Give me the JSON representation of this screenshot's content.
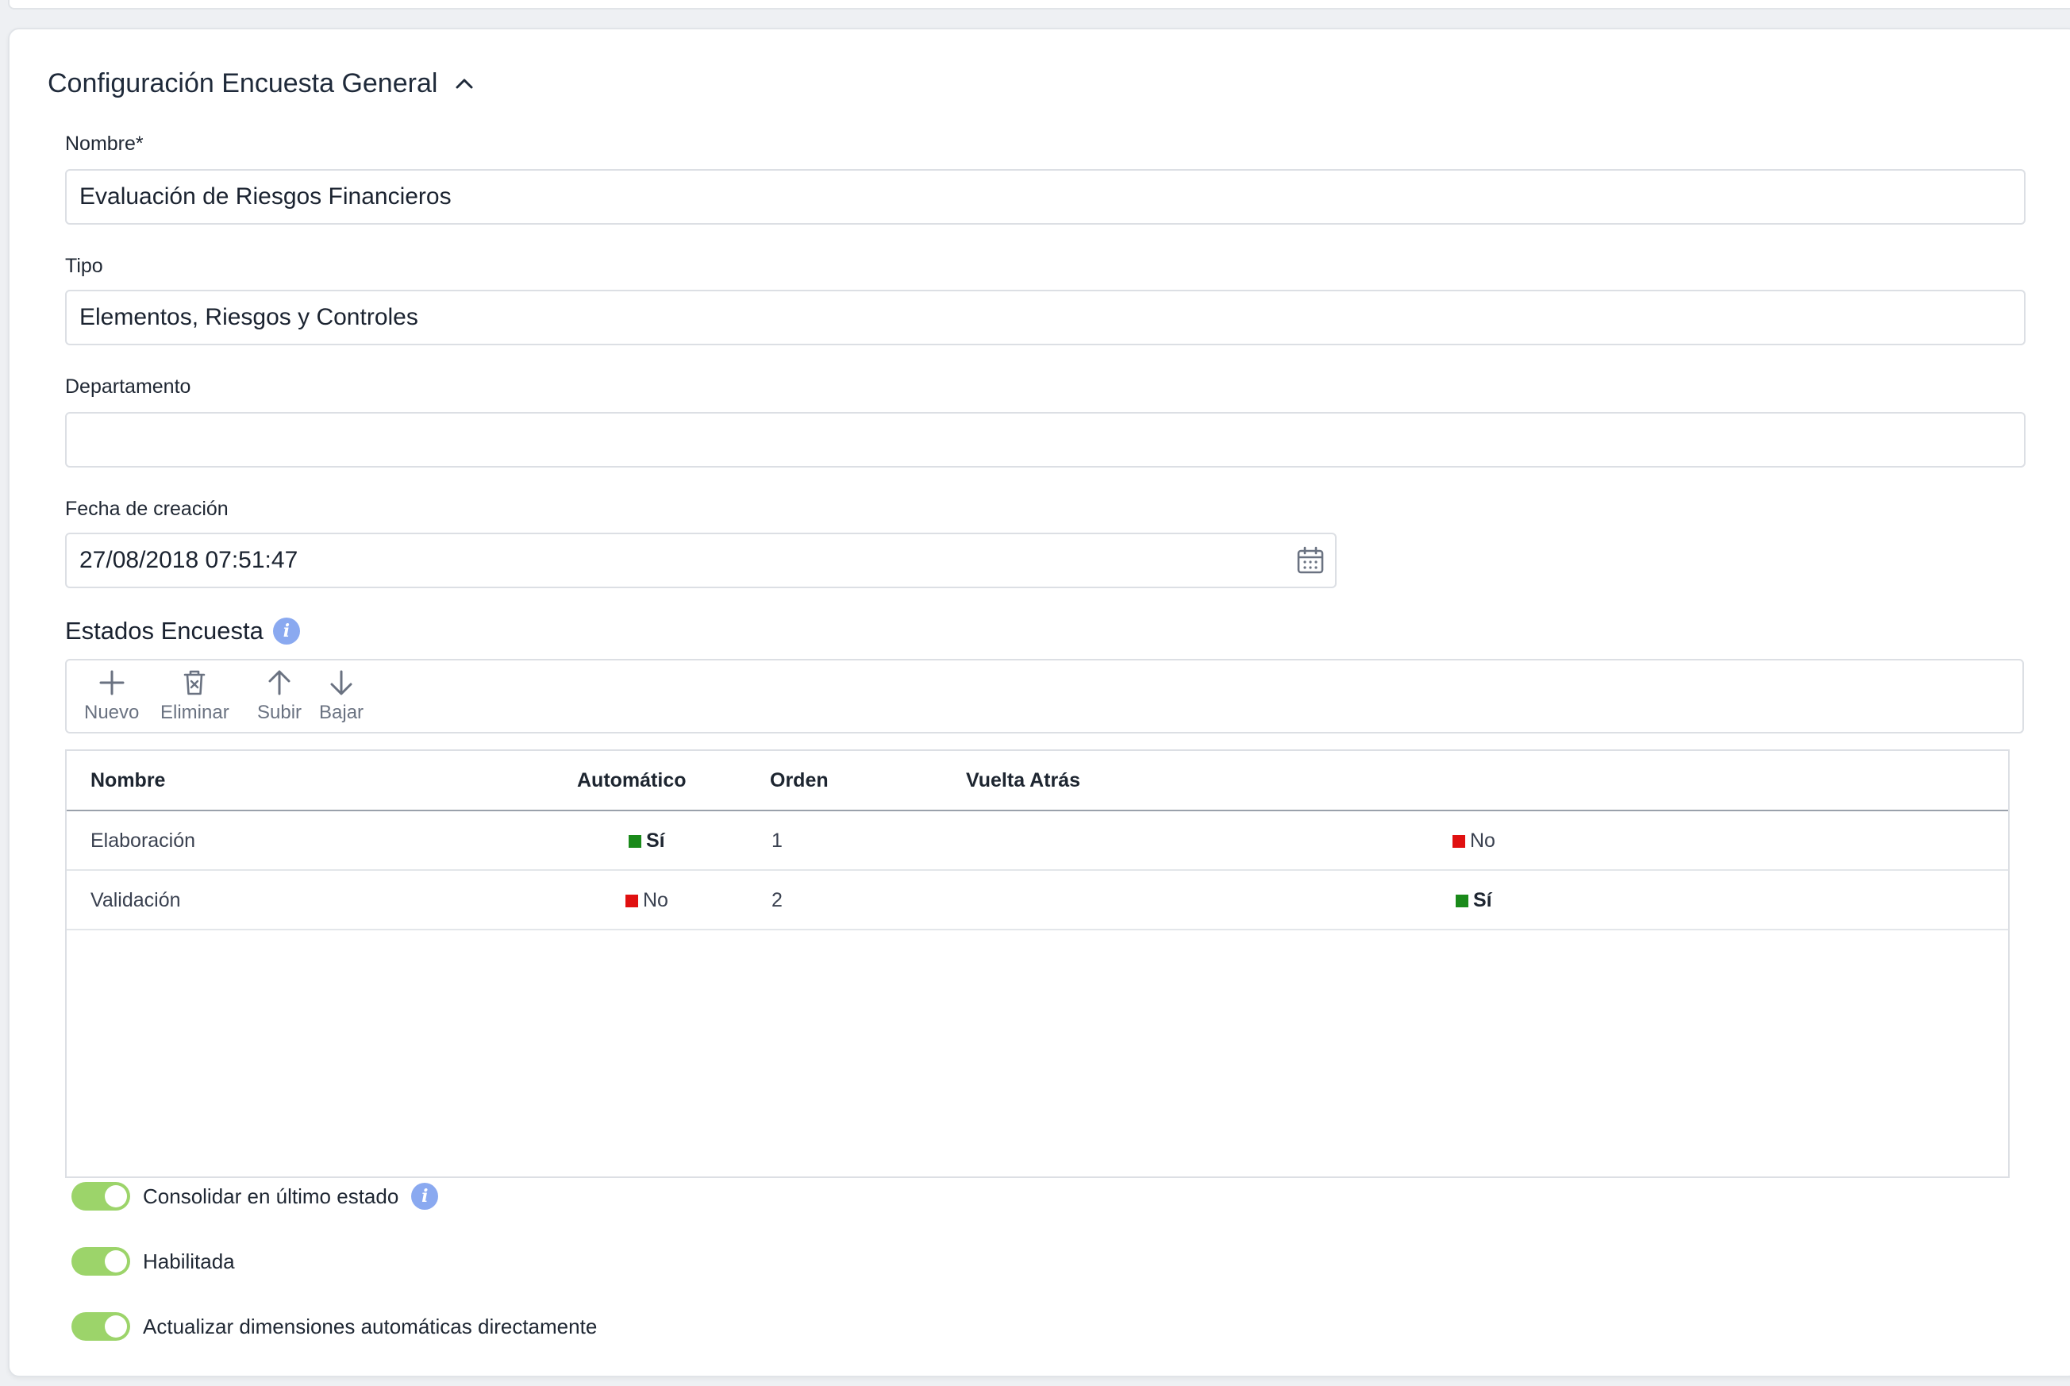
{
  "section": {
    "title": "Configuración Encuesta General",
    "chevron_icon": "chevron-up-icon"
  },
  "fields": {
    "nombre": {
      "label": "Nombre*",
      "value": "Evaluación de Riesgos Financieros"
    },
    "tipo": {
      "label": "Tipo",
      "value": "Elementos, Riesgos y Controles"
    },
    "departamento": {
      "label": "Departamento",
      "value": ""
    },
    "fecha": {
      "label": "Fecha de creación",
      "value": "27/08/2018 07:51:47",
      "icon": "calendar-icon"
    }
  },
  "estados": {
    "title": "Estados Encuesta",
    "toolbar": {
      "nuevo": "Nuevo",
      "eliminar": "Eliminar",
      "subir": "Subir",
      "bajar": "Bajar"
    },
    "columns": [
      "Nombre",
      "Automático",
      "Orden",
      "Vuelta Atrás"
    ],
    "rows": [
      {
        "nombre": "Elaboración",
        "automatico": "Sí",
        "orden": "1",
        "vuelta": "No"
      },
      {
        "nombre": "Validación",
        "automatico": "No",
        "orden": "2",
        "vuelta": "Sí"
      }
    ]
  },
  "toggles": [
    {
      "label": "Consolidar en último estado",
      "on": true
    },
    {
      "label": "Habilitada",
      "on": true
    },
    {
      "label": "Actualizar dimensiones automáticas directamente",
      "on": true
    }
  ],
  "colors": {
    "yes": "#1a8a1a",
    "no": "#e01010",
    "toggle_on": "#9cd46a",
    "info": "#8aa9f0"
  }
}
